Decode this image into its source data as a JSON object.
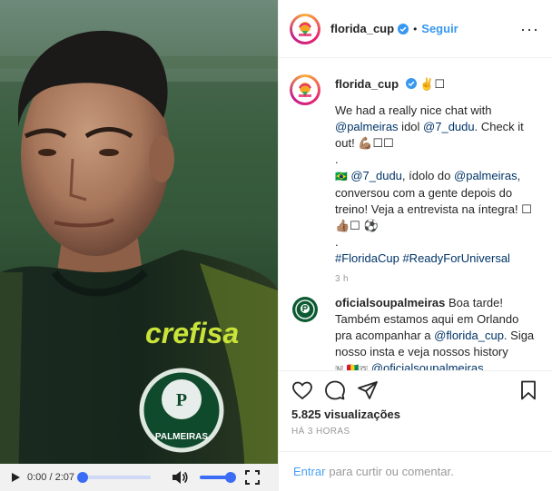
{
  "colors": {
    "accent": "#3897f0",
    "mention": "#003569",
    "muted": "#999999"
  },
  "video": {
    "time": "0:00 / 2:07",
    "jersey_sponsor": "crefisa",
    "crest_text": "PALMEIRAS",
    "icons": [
      "play-icon",
      "volume-icon",
      "fullscreen-icon"
    ]
  },
  "header": {
    "username": "florida_cup",
    "dot": "•",
    "follow_label": "Seguir",
    "more": "···"
  },
  "caption": {
    "username": "florida_cup",
    "suffix": "✌️☐",
    "lines": {
      "l1": "We had a really nice chat with",
      "l2_m1": "@palmeiras",
      "l2_t": " idol ",
      "l2_m2": "@7_dudu",
      "l2_t2": ". Check it",
      "l3": "out! 💪🏽☐☐",
      "l4": ".",
      "l5_flag": "🇧🇷",
      "l5_m": "@7_dudu",
      "l5_t": ", ídolo do ",
      "l5_m2": "@palmeiras",
      "l5_t2": ",",
      "l6": "conversou com a gente depois do",
      "l7": "treino! Veja a entrevista na íntegra! ☐",
      "l8": "👍🏽☐ ⚽",
      "l9": ".",
      "l10_h1": "#FloridaCup",
      "l10_h2": "#ReadyForUniversal"
    },
    "timestamp": "3 h"
  },
  "comment": {
    "username": "oficialsoupalmeiras",
    "l1": " Boa tarde!",
    "l2": "Também estamos aqui em Orlando",
    "l3_t": "pra acompanhar a ",
    "l3_m": "@florida_cup",
    "l3_t2": ". Siga",
    "l4": "nosso insta e veja nossos history",
    "l5_glyphs": "🇳 🇬🇳🇬",
    "l5_m": "@oficialsoupalmeiras"
  },
  "actions": {
    "icons": [
      "heart-icon",
      "comment-icon",
      "share-icon",
      "bookmark-icon"
    ],
    "views_count": "5.825",
    "views_label": "visualizações",
    "age": "HÁ 3 HORAS"
  },
  "add_comment": {
    "enter_label": "Entrar",
    "text": "para curtir ou comentar."
  }
}
